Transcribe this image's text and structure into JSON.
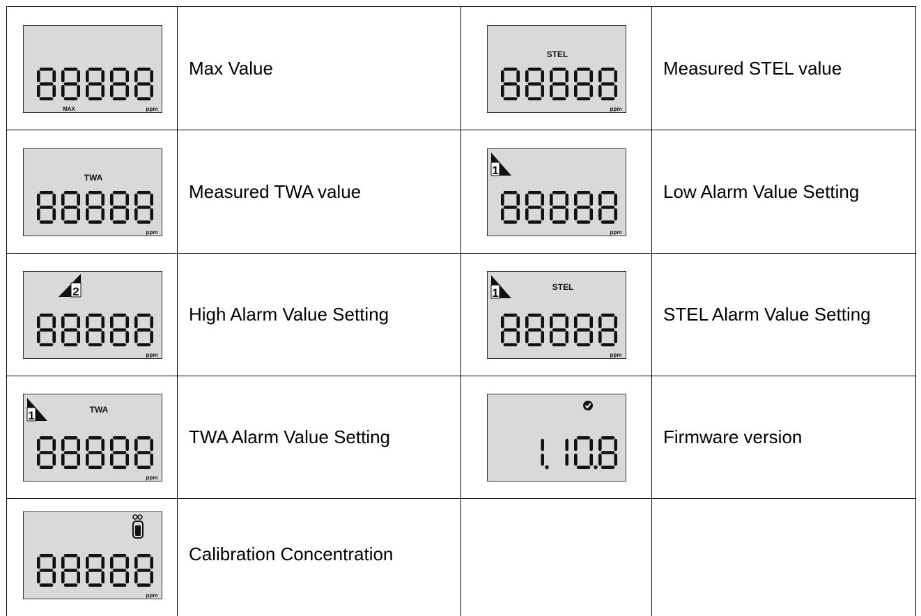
{
  "rows": [
    {
      "left": {
        "description": "Max Value",
        "lcd": {
          "digits": "88888",
          "unit": "ppm",
          "top_label": "",
          "bottom_label": "MAX",
          "alarm": "",
          "icon": ""
        }
      },
      "right": {
        "description": "Measured STEL value",
        "lcd": {
          "digits": "88888",
          "unit": "ppm",
          "top_label": "STEL",
          "bottom_label": "",
          "alarm": "",
          "icon": ""
        }
      }
    },
    {
      "left": {
        "description": "Measured TWA value",
        "lcd": {
          "digits": "88888",
          "unit": "ppm",
          "top_label": "TWA",
          "bottom_label": "",
          "alarm": "",
          "icon": ""
        }
      },
      "right": {
        "description": "Low Alarm Value Setting",
        "lcd": {
          "digits": "88888",
          "unit": "ppm",
          "top_label": "",
          "bottom_label": "",
          "alarm": "1",
          "icon": ""
        }
      }
    },
    {
      "left": {
        "description": "High Alarm Value Setting",
        "lcd": {
          "digits": "88888",
          "unit": "ppm",
          "top_label": "",
          "bottom_label": "",
          "alarm": "2",
          "icon": ""
        }
      },
      "right": {
        "description": "STEL Alarm Value Setting",
        "lcd": {
          "digits": "88888",
          "unit": "ppm",
          "top_label": "STEL",
          "bottom_label": "",
          "alarm": "1",
          "icon": ""
        }
      }
    },
    {
      "left": {
        "description": "TWA Alarm Value Setting",
        "lcd": {
          "digits": "88888",
          "unit": "ppm",
          "top_label": "TWA",
          "bottom_label": "",
          "alarm": "1",
          "icon": ""
        }
      },
      "right": {
        "description": "Firmware version",
        "lcd": {
          "digits": "1.10.8",
          "unit": "",
          "top_label": "",
          "bottom_label": "",
          "alarm": "",
          "icon": "check-circle-icon"
        }
      }
    },
    {
      "left": {
        "description": "Calibration Concentration",
        "lcd": {
          "digits": "88888",
          "unit": "ppm",
          "top_label": "",
          "bottom_label": "",
          "alarm": "",
          "icon": "gas-cylinder-icon"
        }
      },
      "right": {
        "description": "",
        "lcd": null
      }
    }
  ],
  "colors": {
    "lcd_background": "#d9d9d9",
    "segment": "#111111",
    "grid_line": "#000000"
  }
}
